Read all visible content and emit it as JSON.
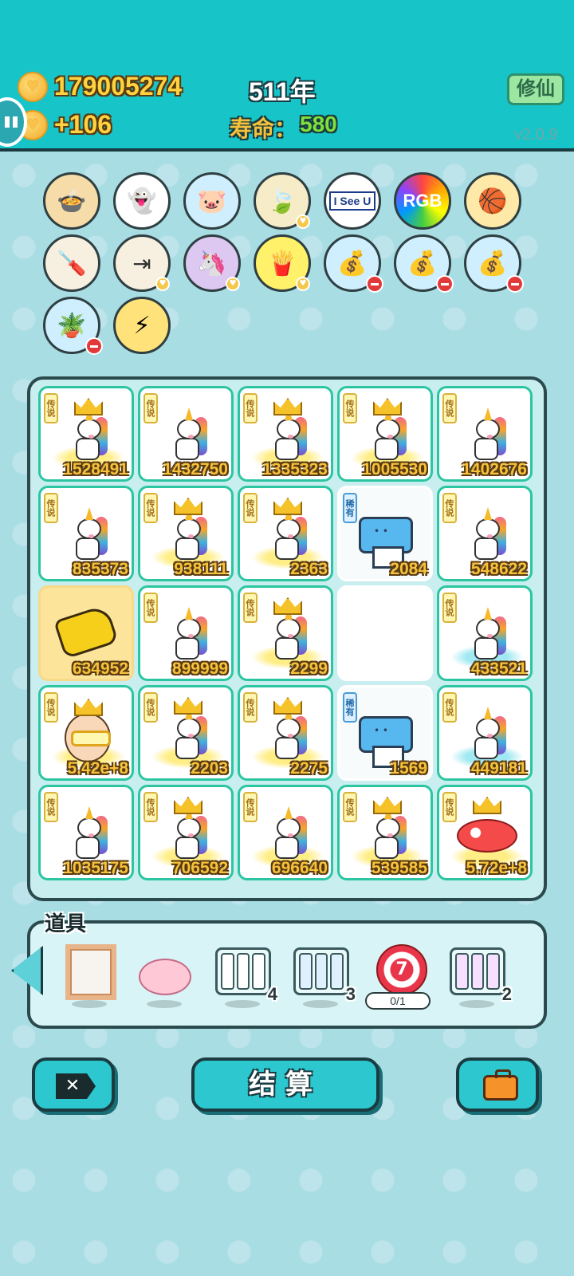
{
  "header": {
    "coins": "179005274",
    "income": "+106",
    "year": "511年",
    "life_label": "寿命：",
    "life_value": "580",
    "cultivate_label": "修仙",
    "version": "v2.0.9"
  },
  "upgrades": [
    {
      "name": "dog-bowl-icon",
      "badge": "none"
    },
    {
      "name": "ghost-icon",
      "badge": "none"
    },
    {
      "name": "piggy-bank-icon",
      "badge": "none"
    },
    {
      "name": "leaf-icon",
      "badge": "heart"
    },
    {
      "name": "i-see-u-icon",
      "label": "I See U",
      "badge": "none"
    },
    {
      "name": "rgb-icon",
      "label": "RGB",
      "badge": "none"
    },
    {
      "name": "basketballs-icon",
      "badge": "none"
    },
    {
      "name": "screwdriver-icon",
      "badge": "none"
    },
    {
      "name": "skip-icon",
      "badge": "heart"
    },
    {
      "name": "twin-unicorns-icon",
      "badge": "heart"
    },
    {
      "name": "fries-icon",
      "badge": "heart"
    },
    {
      "name": "bag-icon",
      "badge": "minus"
    },
    {
      "name": "bag-icon",
      "badge": "minus"
    },
    {
      "name": "bag-icon",
      "badge": "minus"
    },
    {
      "name": "flower-pot-icon",
      "badge": "minus"
    },
    {
      "name": "lightning-icon",
      "badge": "none"
    }
  ],
  "board": {
    "legend_tag": "传说",
    "rare_tag": "稀有",
    "cells": [
      {
        "type": "unicorn",
        "crown": true,
        "halo": "yellow",
        "value": "1528491"
      },
      {
        "type": "unicorn",
        "crown": false,
        "halo": "none",
        "value": "1432750"
      },
      {
        "type": "unicorn",
        "crown": true,
        "halo": "yellow",
        "value": "1335323"
      },
      {
        "type": "unicorn",
        "crown": true,
        "halo": "yellow",
        "value": "1005530"
      },
      {
        "type": "unicorn",
        "crown": false,
        "halo": "none",
        "value": "1402676"
      },
      {
        "type": "unicorn",
        "crown": false,
        "halo": "none",
        "value": "835373"
      },
      {
        "type": "unicorn",
        "crown": true,
        "halo": "yellow",
        "value": "938111"
      },
      {
        "type": "unicorn",
        "crown": true,
        "halo": "yellow",
        "value": "2363"
      },
      {
        "type": "printer",
        "value": "2084"
      },
      {
        "type": "unicorn",
        "crown": false,
        "halo": "none",
        "value": "548622"
      },
      {
        "type": "hand",
        "value": "634952"
      },
      {
        "type": "unicorn",
        "crown": false,
        "halo": "none",
        "value": "899999"
      },
      {
        "type": "unicorn",
        "crown": true,
        "halo": "yellow",
        "value": "2299"
      },
      {
        "type": "empty",
        "value": ""
      },
      {
        "type": "unicorn",
        "crown": false,
        "halo": "cyan",
        "value": "433521"
      },
      {
        "type": "bald",
        "value": "5.42e+8"
      },
      {
        "type": "unicorn",
        "crown": true,
        "halo": "yellow",
        "value": "2203"
      },
      {
        "type": "unicorn",
        "crown": true,
        "halo": "yellow",
        "value": "2275"
      },
      {
        "type": "printer",
        "value": "1569"
      },
      {
        "type": "unicorn",
        "crown": false,
        "halo": "cyan",
        "value": "449181"
      },
      {
        "type": "unicorn",
        "crown": false,
        "halo": "none",
        "value": "1035175"
      },
      {
        "type": "unicorn",
        "crown": true,
        "halo": "yellow",
        "value": "706592"
      },
      {
        "type": "unicorn",
        "crown": false,
        "halo": "yellow",
        "value": "696640"
      },
      {
        "type": "unicorn",
        "crown": true,
        "halo": "yellow",
        "value": "539585"
      },
      {
        "type": "fish",
        "value": "5.72e+8"
      }
    ]
  },
  "props": {
    "title": "道具",
    "items": [
      {
        "name": "picture-frame-prop",
        "count": ""
      },
      {
        "name": "piggy-bank-prop",
        "count": ""
      },
      {
        "name": "empty-slots-prop",
        "count": "4"
      },
      {
        "name": "rare-slots-prop",
        "count": "3"
      },
      {
        "name": "target-prop",
        "target_label": "7",
        "count": "0/1"
      },
      {
        "name": "legend-slots-prop",
        "count": "2"
      }
    ]
  },
  "buttons": {
    "close_label": "✕",
    "settle_label": "结算"
  }
}
